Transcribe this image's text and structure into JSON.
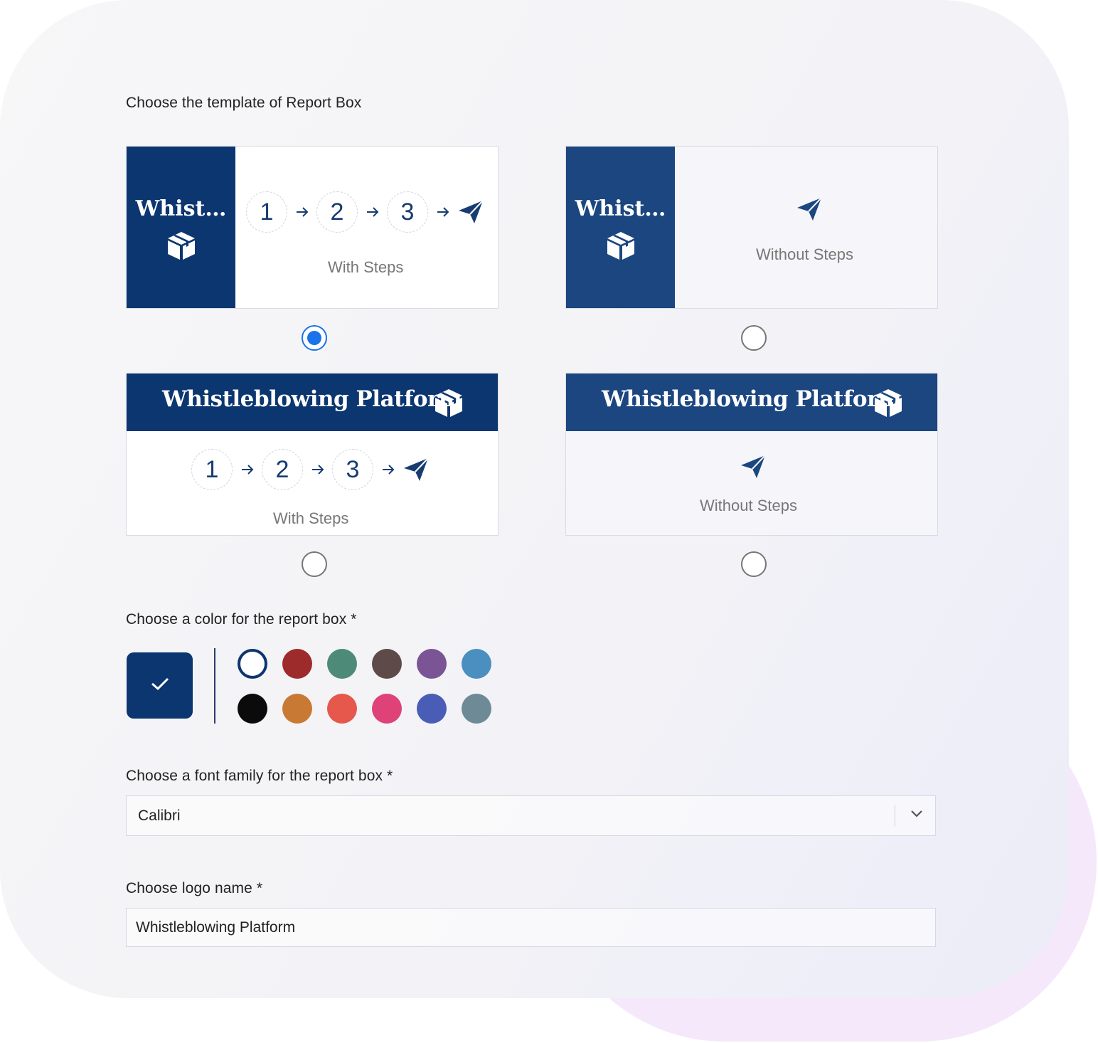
{
  "template_section": {
    "label": "Choose the template of Report Box",
    "templates": [
      {
        "logo_text": "Whist…",
        "steps": [
          "1",
          "2",
          "3"
        ],
        "caption": "With Steps",
        "selected": true
      },
      {
        "logo_text": "Whist…",
        "caption": "Without Steps",
        "selected": false
      },
      {
        "logo_text": "Whistleblowing Platform",
        "steps": [
          "1",
          "2",
          "3"
        ],
        "caption": "With Steps",
        "selected": false
      },
      {
        "logo_text": "Whistleblowing Platform",
        "caption": "Without Steps",
        "selected": false
      }
    ]
  },
  "color_section": {
    "label": "Choose a color for the report box *",
    "selected_color": "#0c3670",
    "palette": [
      "#ffffff",
      "#9e2b2b",
      "#4e8a78",
      "#5e4a49",
      "#7a5494",
      "#4a8fc0",
      "#0b0b0b",
      "#c87a35",
      "#e5584b",
      "#de4277",
      "#4a5db6",
      "#6f8a97"
    ],
    "icons": {
      "selected": "check-icon"
    }
  },
  "font_section": {
    "label": "Choose a font family for the report box *",
    "value": "Calibri",
    "icons": {
      "dropdown": "chevron-down-icon"
    }
  },
  "logo_section": {
    "label": "Choose logo name *",
    "value": "Whistleblowing Platform"
  },
  "theme": {
    "brand": "#0c3670",
    "radio_accent": "#1a73e8"
  }
}
